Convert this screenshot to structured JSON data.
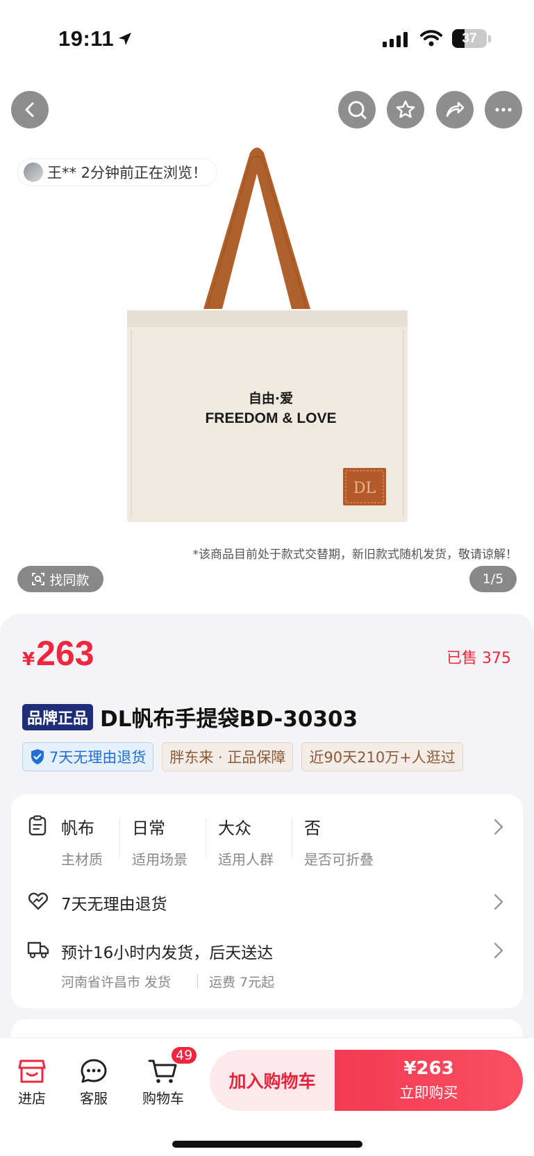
{
  "status_bar": {
    "time": "19:11",
    "battery": "37"
  },
  "product": {
    "viewers_text": "王** 2分钟前正在浏览！",
    "bag_text_cn": "自由·爱",
    "bag_text_en": "FREEDOM & LOVE",
    "bag_logo": "DL",
    "notice": "*该商品目前处于款式交替期，新旧款式随机发货，敬请谅解！",
    "find_same": "找同款",
    "page_indicator": "1/5"
  },
  "price": {
    "symbol": "¥",
    "value": "263",
    "sold": "已售 375"
  },
  "title": {
    "badge": "品牌正品",
    "text": "DL帆布手提袋BD-30303"
  },
  "tags": [
    "7天无理由退货",
    "胖东来 · 正品保障",
    "近90天210万+人逛过"
  ],
  "attributes": [
    {
      "value": "帆布",
      "key": "主材质"
    },
    {
      "value": "日常",
      "key": "适用场景"
    },
    {
      "value": "大众",
      "key": "适用人群"
    },
    {
      "value": "否",
      "key": "是否可折叠"
    }
  ],
  "return_policy": "7天无理由退货",
  "shipping": {
    "main": "预计16小时内发货，后天送达",
    "origin": "河南省许昌市 发货",
    "fee": "运费 7元起"
  },
  "bottom_bar": {
    "store": "进店",
    "service": "客服",
    "cart": "购物车",
    "cart_count": "49",
    "add_to_cart": "加入购物车",
    "buy_price": "¥263",
    "buy_now": "立即购买"
  },
  "colors": {
    "accent": "#f0253e",
    "brand_badge": "#1d2d7a"
  },
  "icons": [
    "location-arrow-icon",
    "signal-icon",
    "wifi-icon",
    "back-icon",
    "search-icon",
    "star-icon",
    "share-icon",
    "more-icon",
    "find-same-icon",
    "shield-icon",
    "clipboard-icon",
    "return-icon",
    "truck-icon",
    "chevron-right-icon",
    "store-icon",
    "chat-icon",
    "cart-icon"
  ]
}
